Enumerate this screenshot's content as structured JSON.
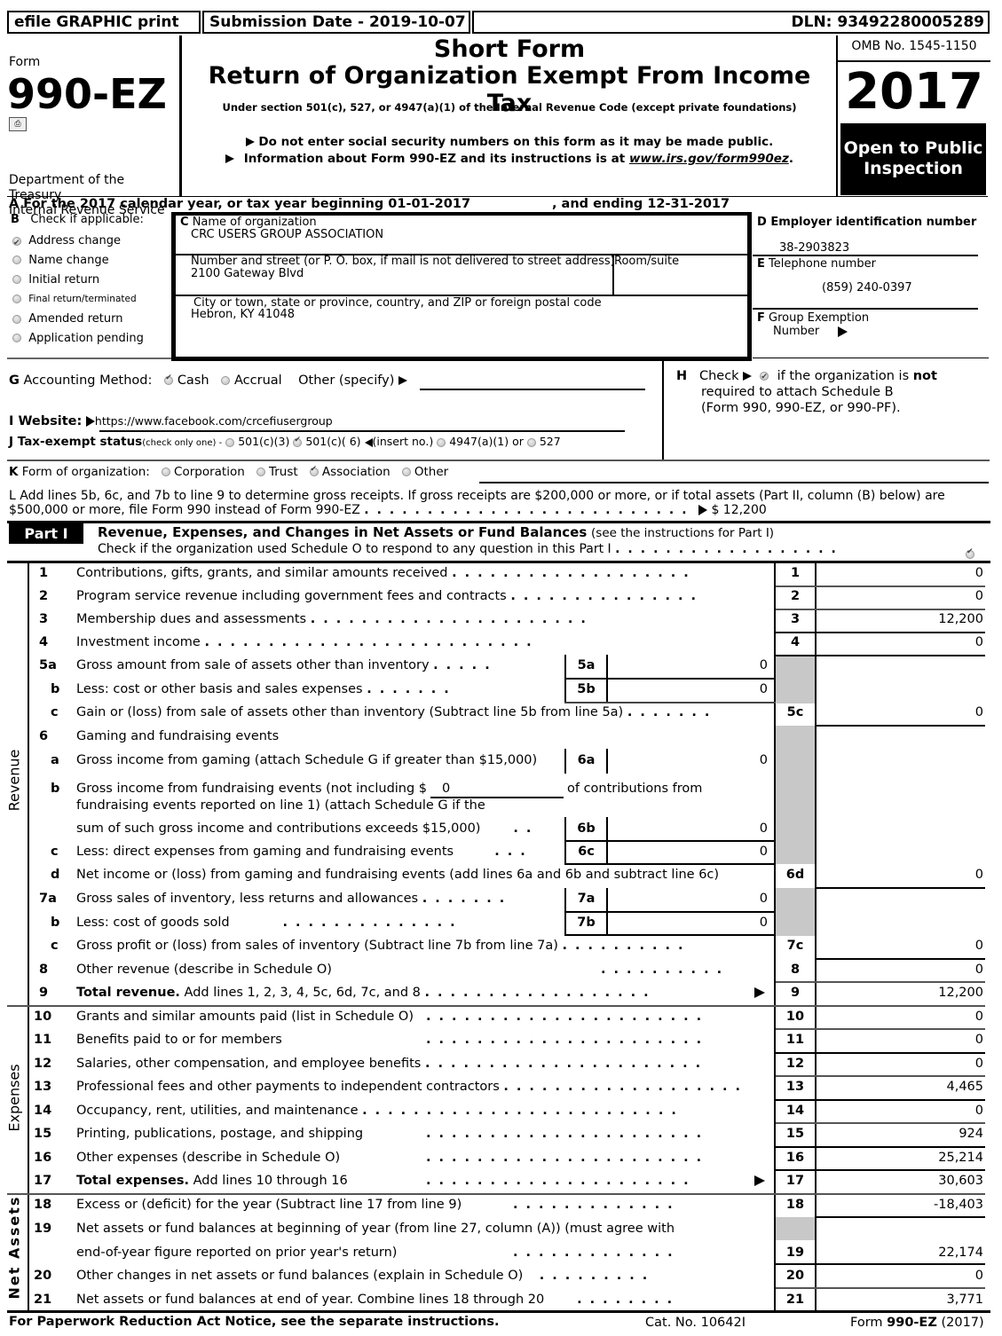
{
  "header": {
    "efile_label": "efile GRAPHIC print",
    "submission_date": "Submission Date - 2019-10-07",
    "dln": "DLN: 93492280005289",
    "form_word": "Form",
    "form_number": "990-EZ",
    "department": "Department of the Treasury",
    "irs": "Internal Revenue Service",
    "title_short": "Short Form",
    "title_main": "Return of Organization Exempt From Income Tax",
    "subtitle": "Under section 501(c), 527, or 4947(a)(1) of the Internal Revenue Code (except private foundations)",
    "notice_ssn": "Do not enter social security numbers on this form as it may be made public.",
    "notice_info_prefix": "Information about Form 990-EZ and its instructions is at ",
    "notice_info_link": "www.irs.gov/form990ez",
    "notice_info_suffix": ".",
    "omb": "OMB No. 1545-1150",
    "year": "2017",
    "open_public": "Open to Public Inspection"
  },
  "section_a": {
    "text": "A  For the 2017 calendar year, or tax year beginning 01-01-2017",
    "ending": ", and ending 12-31-2017"
  },
  "section_b": {
    "label": "B",
    "title": "Check if applicable:",
    "items": [
      {
        "label": "Address change",
        "checked": true
      },
      {
        "label": "Name change",
        "checked": false
      },
      {
        "label": "Initial return",
        "checked": false
      },
      {
        "label": "Final return/terminated",
        "checked": false
      },
      {
        "label": "Amended return",
        "checked": false
      },
      {
        "label": "Application pending",
        "checked": false
      }
    ]
  },
  "section_c": {
    "name_label": "Name of organization",
    "name_value": "CRC USERS GROUP ASSOCIATION",
    "street_label": "Number and street (or P. O. box, if mail is not delivered to street address)",
    "room_label": "Room/suite",
    "street_value": "2100 Gateway Blvd",
    "city_label": "City or town, state or province, country, and ZIP or foreign postal code",
    "city_value": "Hebron, KY  41048"
  },
  "section_d": {
    "label": "D Employer identification number",
    "value": "38-2903823"
  },
  "section_e": {
    "label": "Telephone number",
    "value": "(859) 240-0397"
  },
  "section_f": {
    "label": "Group Exemption",
    "label2": "Number",
    "value": ""
  },
  "section_g": {
    "label": "Accounting Method:",
    "options": [
      {
        "label": "Cash",
        "checked": true
      },
      {
        "label": "Accrual",
        "checked": false
      }
    ],
    "other_label": "Other (specify)",
    "other_value": ""
  },
  "section_h": {
    "line1_pre": "Check",
    "line1_post": "if the organization is",
    "line1_bold": "not",
    "line2": "required to attach Schedule B",
    "line3": "(Form 990, 990-EZ, or 990-PF).",
    "checked": true
  },
  "section_i": {
    "label": "I Website:",
    "value": "https://www.facebook.com/crcefiusergroup"
  },
  "section_j": {
    "label": "J Tax-exempt status",
    "hint": "(check only one) -",
    "opt1": "501(c)(3)",
    "opt2": "501(c)( 6)",
    "insert": "(insert no.)",
    "opt3": "4947(a)(1) or",
    "opt4": "527"
  },
  "section_k": {
    "label": "Form of organization:",
    "options": [
      {
        "label": "Corporation",
        "checked": false
      },
      {
        "label": "Trust",
        "checked": false
      },
      {
        "label": "Association",
        "checked": true
      },
      {
        "label": "Other",
        "checked": false
      }
    ]
  },
  "section_l": {
    "line1": "L Add lines 5b, 6c, and 7b to line 9 to determine gross receipts. If gross receipts are $200,000 or more, or if total assets (Part II, column (B) below) are",
    "line2": "$500,000 or more, file Form 990 instead of Form 990-EZ",
    "amount": "$ 12,200"
  },
  "part1": {
    "tag": "Part I",
    "title": "Revenue, Expenses, and Changes in Net Assets or Fund Balances",
    "title_note": "(see the instructions for Part I)",
    "schedule_o_check": "Check if the organization used Schedule O to respond to any question in this Part I",
    "schedule_o_checked": true,
    "side_revenue": "Revenue",
    "side_expenses": "Expenses",
    "side_net_assets": "Net Assets"
  },
  "lines": {
    "l1": {
      "num": "1",
      "text": "Contributions, gifts, grants, and similar amounts received",
      "box": "1",
      "value": "0"
    },
    "l2": {
      "num": "2",
      "text": "Program service revenue including government fees and contracts",
      "box": "2",
      "value": "0"
    },
    "l3": {
      "num": "3",
      "text": "Membership dues and assessments",
      "box": "3",
      "value": "12,200"
    },
    "l4": {
      "num": "4",
      "text": "Investment income",
      "box": "4",
      "value": "0"
    },
    "l5a": {
      "num": "5a",
      "text": "Gross amount from sale of assets other than inventory",
      "box": "5a",
      "value": "0"
    },
    "l5b": {
      "num": "b",
      "text": "Less: cost or other basis and sales expenses",
      "box": "5b",
      "value": "0"
    },
    "l5c": {
      "num": "c",
      "text": "Gain or (loss) from sale of assets other than inventory (Subtract line 5b from line 5a)",
      "box": "5c",
      "value": "0"
    },
    "l6": {
      "num": "6",
      "text": "Gaming and fundraising events"
    },
    "l6a": {
      "num": "a",
      "text": "Gross income from gaming (attach Schedule G if greater than $15,000)",
      "box": "6a",
      "value": "0"
    },
    "l6b": {
      "num": "b",
      "text1": "Gross income from fundraising events (not including $",
      "inline_value": "0",
      "text1b": "of contributions from",
      "text2": "fundraising events reported on line 1) (attach Schedule G if the",
      "text3": "sum of such gross income and contributions exceeds $15,000)",
      "box": "6b",
      "value": "0"
    },
    "l6c": {
      "num": "c",
      "text": "Less: direct expenses from gaming and fundraising events",
      "box": "6c",
      "value": "0"
    },
    "l6d": {
      "num": "d",
      "text": "Net income or (loss) from gaming and fundraising events (add lines 6a and 6b and subtract line 6c)",
      "box": "6d",
      "value": "0"
    },
    "l7a": {
      "num": "7a",
      "text": "Gross sales of inventory, less returns and allowances",
      "box": "7a",
      "value": "0"
    },
    "l7b": {
      "num": "b",
      "text": "Less: cost of goods sold",
      "box": "7b",
      "value": "0"
    },
    "l7c": {
      "num": "c",
      "text": "Gross profit or (loss) from sales of inventory (Subtract line 7b from line 7a)",
      "box": "7c",
      "value": "0"
    },
    "l8": {
      "num": "8",
      "text": "Other revenue (describe in Schedule O)",
      "box": "8",
      "value": "0"
    },
    "l9": {
      "num": "9",
      "text_bold": "Total revenue.",
      "text": " Add lines 1, 2, 3, 4, 5c, 6d, 7c, and 8",
      "box": "9",
      "value": "12,200"
    },
    "l10": {
      "num": "10",
      "text": "Grants and similar amounts paid (list in Schedule O)",
      "box": "10",
      "value": "0"
    },
    "l11": {
      "num": "11",
      "text": "Benefits paid to or for members",
      "box": "11",
      "value": "0"
    },
    "l12": {
      "num": "12",
      "text": "Salaries, other compensation, and employee benefits",
      "box": "12",
      "value": "0"
    },
    "l13": {
      "num": "13",
      "text": "Professional fees and other payments to independent contractors",
      "box": "13",
      "value": "4,465"
    },
    "l14": {
      "num": "14",
      "text": "Occupancy, rent, utilities, and maintenance",
      "box": "14",
      "value": "0"
    },
    "l15": {
      "num": "15",
      "text": "Printing, publications, postage, and shipping",
      "box": "15",
      "value": "924"
    },
    "l16": {
      "num": "16",
      "text": "Other expenses (describe in Schedule O)",
      "box": "16",
      "value": "25,214"
    },
    "l17": {
      "num": "17",
      "text_bold": "Total expenses.",
      "text": " Add lines 10 through 16",
      "box": "17",
      "value": "30,603"
    },
    "l18": {
      "num": "18",
      "text": "Excess or (deficit) for the year (Subtract line 17 from line 9)",
      "box": "18",
      "value": "-18,403"
    },
    "l19": {
      "num": "19",
      "text1": "Net assets or fund balances at beginning of year (from line 27, column (A)) (must agree with",
      "text2": "end-of-year figure reported on prior year's return)",
      "box": "19",
      "value": "22,174"
    },
    "l20": {
      "num": "20",
      "text": "Other changes in net assets or fund balances (explain in Schedule O)",
      "box": "20",
      "value": "0"
    },
    "l21": {
      "num": "21",
      "text": "Net assets or fund balances at end of year. Combine lines 18 through 20",
      "box": "21",
      "value": "3,771"
    }
  },
  "footer": {
    "paperwork": "For Paperwork Reduction Act Notice, see the separate instructions.",
    "cat_no": "Cat. No. 10642I",
    "form_pre": "Form ",
    "form_bold": "990-EZ",
    "form_year": " (2017)"
  }
}
